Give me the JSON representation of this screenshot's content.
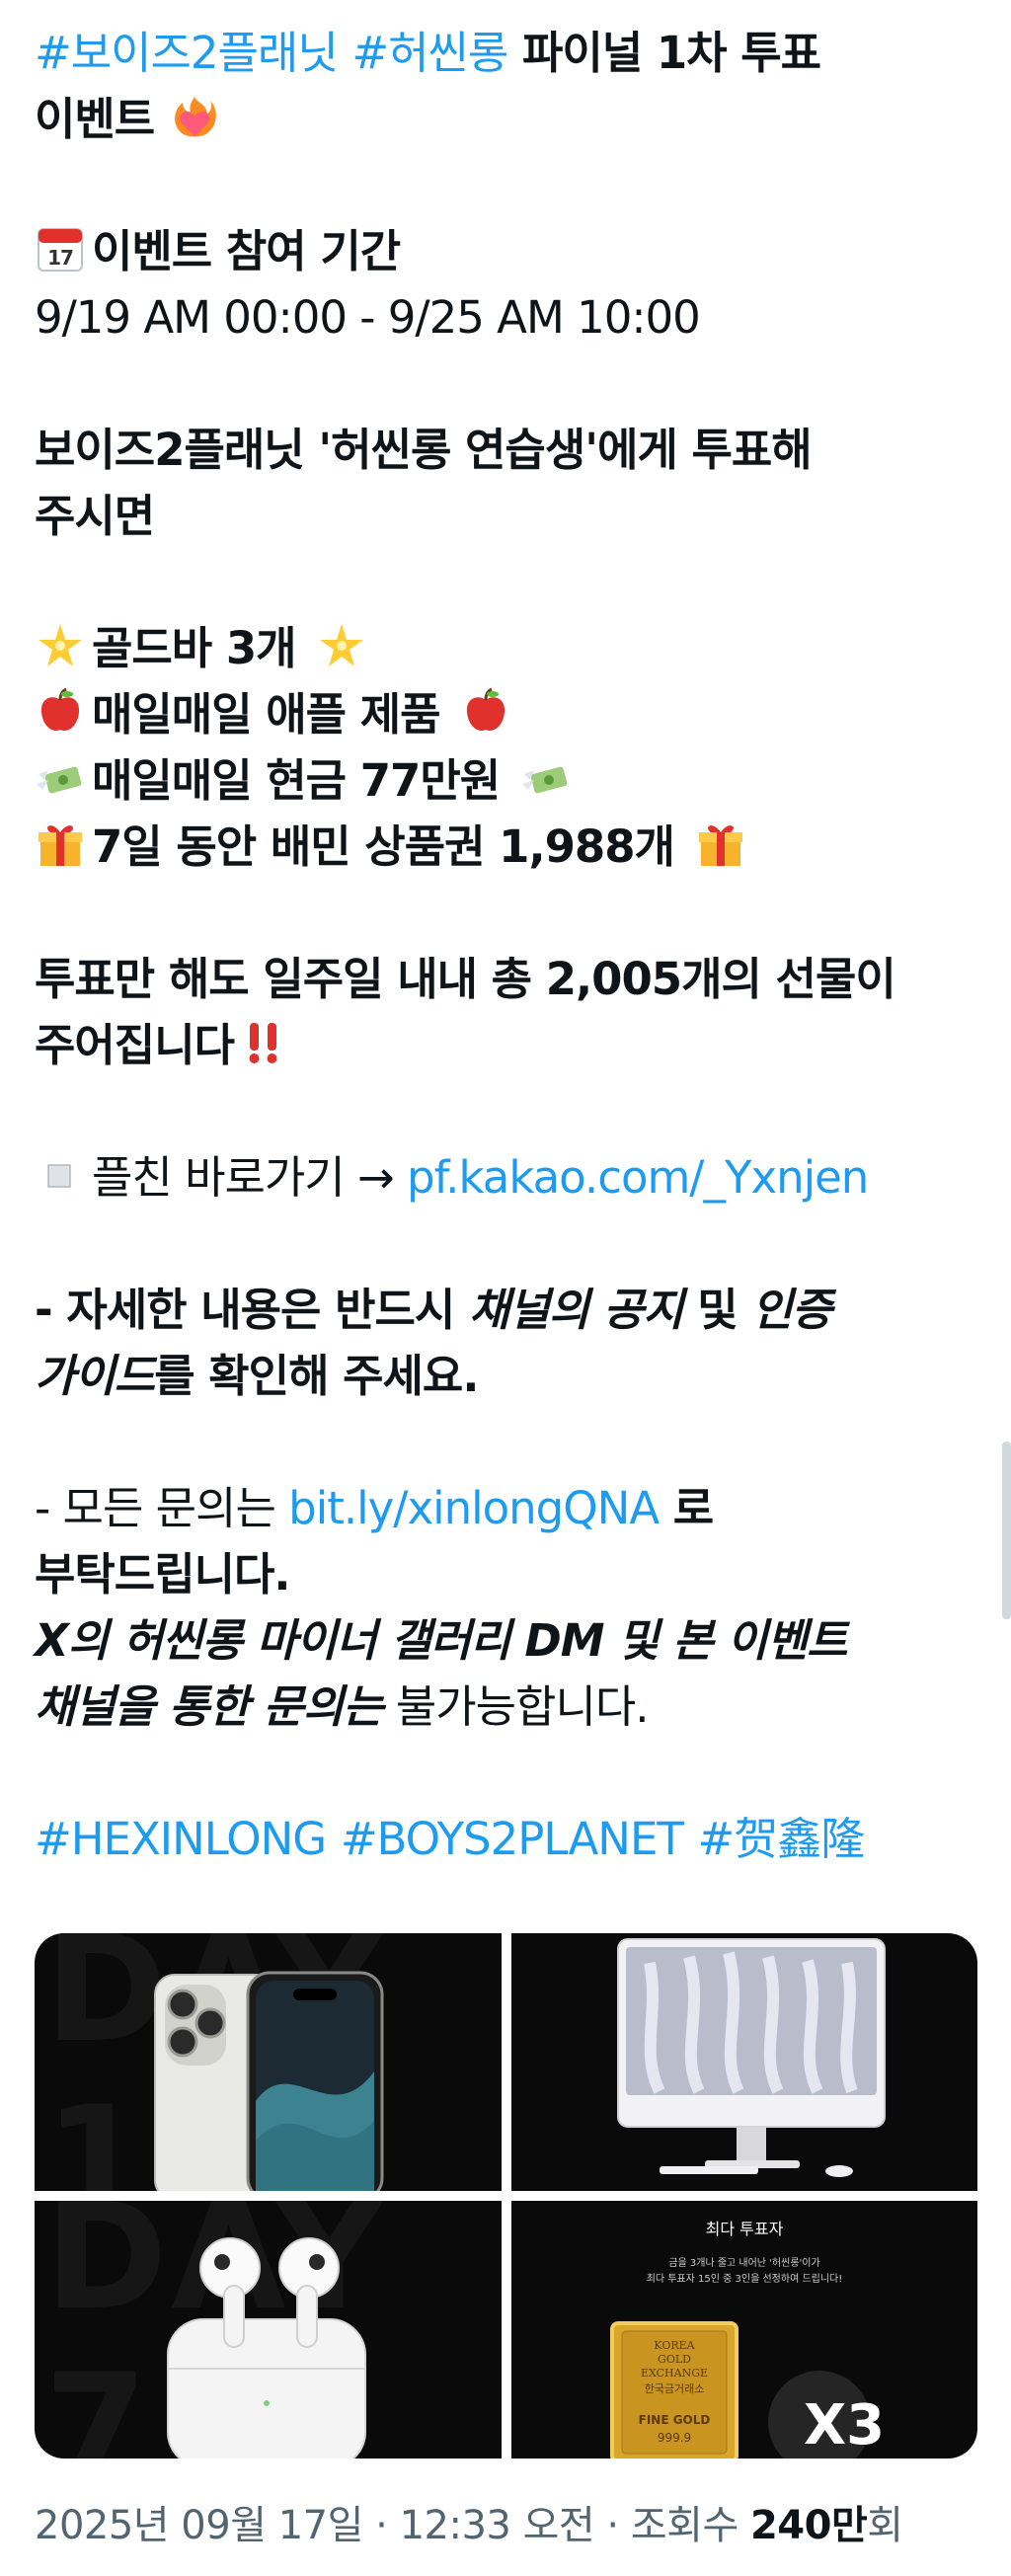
{
  "tweet": {
    "l1_hashtag1": "#보이즈2플래닛",
    "l1_hashtag2": "#허씬롱",
    "l1_text": " 파이널 1차 투표",
    "l2_text": "이벤트",
    "l3_text": "이벤트 참여 기간",
    "l4_text": "9/19 AM 00:00 - 9/25 AM 10:00",
    "l5_text": "보이즈2플래닛 '허씬롱 연습생'에게 투표해",
    "l6_text": "주시면",
    "prize1": "골드바 3개",
    "prize2": "매일매일 애플 제품",
    "prize3": "매일매일 현금 77만원",
    "prize4": "7일 동안 배민 상품권 1,988개",
    "l11_text": "투표만 해도 일주일 내내 총 2,005개의 선물이",
    "l12_text": "주어집니다",
    "plus_friend_label": "플친 바로가기 → ",
    "plus_friend_link": "pf.kakao.com/_Yxnjen",
    "detail_prefix": "- 자세한 내용은 반드시 ",
    "detail_italic1": "채널의 공지",
    "detail_mid": " 및 ",
    "detail_italic2": "인증",
    "detail_italic3": "가이드",
    "detail_suffix": "를 확인해 주세요.",
    "inquiry_prefix": "- 모든 문의는 ",
    "inquiry_link": "bit.ly/xinlongQNA",
    "inquiry_suffix": " 로",
    "inquiry_line2": "부탁드립니다.",
    "inquiry_italic1": "X의 허씬롱 마이너 갤러리 DM 및 본 이벤트",
    "inquiry_italic2": "채널을 통한 문의는",
    "inquiry_end": " 불가능합니다.",
    "hashtags": [
      "#HEXINLONG",
      "#BOYS2PLANET",
      "#贺鑫隆"
    ]
  },
  "media": {
    "tile1_bg": "DAY 1",
    "tile3_bg": "DAY 7",
    "tile4_title": "최다 투표자",
    "tile4_desc1": "금을 3개나 줄고 내어난 '허씬롱'이가",
    "tile4_desc2": "최다 투표자 15인 중 3인을 선정하여 드립니다!",
    "gold_line1": "KOREA",
    "gold_line2": "GOLD",
    "gold_line3": "EXCHANGE",
    "gold_line4": "한국금거래소",
    "gold_line5": "FINE GOLD",
    "gold_line6": "999.9",
    "gold_count": "X3"
  },
  "meta": {
    "date": "2025년 09월 17일",
    "separator1": " · ",
    "time": "12:33 오전",
    "separator2": " · ",
    "views_label": "조회수 ",
    "views_count": "240만",
    "views_suffix": "회"
  },
  "colors": {
    "link": "#1d9bf0",
    "text": "#0f1419",
    "meta": "#536471",
    "tile_bg": "#0a0a0a"
  },
  "icons": [
    "heart-on-fire-icon",
    "calendar-icon",
    "glowing-star-icon",
    "red-apple-icon",
    "money-with-wings-icon",
    "gift-icon",
    "double-exclamation-icon",
    "white-square-icon"
  ]
}
